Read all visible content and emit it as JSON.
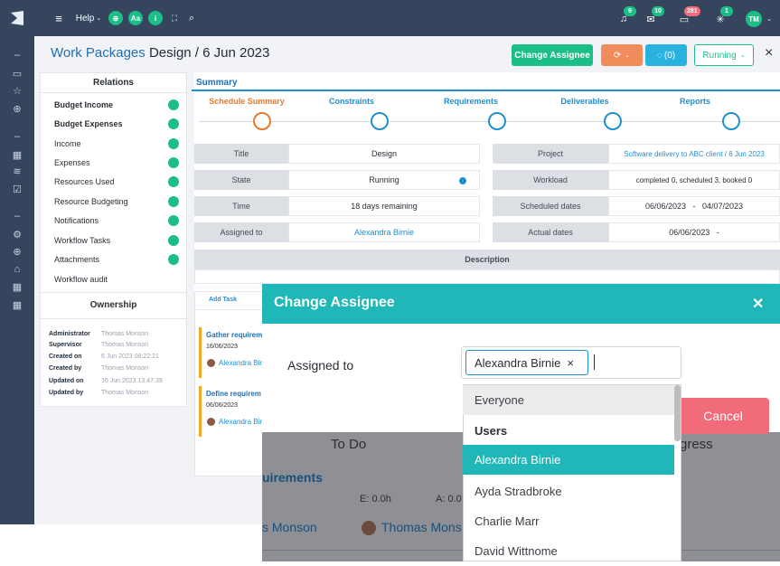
{
  "topbar": {
    "help_label": "Help",
    "aa_label": "Aa",
    "info_label": "i",
    "badges": [
      "9",
      "10",
      "281",
      "1"
    ],
    "avatar_initials": "TM"
  },
  "header": {
    "breadcrumb_module": "Work Packages",
    "record_title": "Design / 6 Jun 2023",
    "change_assignee_label": "Change Assignee",
    "comments_label": "(0)",
    "status_label": "Running",
    "close_label": "×"
  },
  "relations": {
    "title": "Relations",
    "items": [
      {
        "label": "Budget Income",
        "bold": true
      },
      {
        "label": "Budget Expenses",
        "bold": true
      },
      {
        "label": "Income",
        "bold": false
      },
      {
        "label": "Expenses",
        "bold": false
      },
      {
        "label": "Resources Used",
        "bold": false
      },
      {
        "label": "Resource Budgeting",
        "bold": false
      },
      {
        "label": "Notifications",
        "bold": false
      },
      {
        "label": "Workflow Tasks",
        "bold": false
      },
      {
        "label": "Attachments",
        "bold": false
      },
      {
        "label": "Workflow audit",
        "bold": false
      }
    ]
  },
  "ownership": {
    "title": "Ownership",
    "rows": [
      {
        "key": "Administrator",
        "value": "Thomas Monson"
      },
      {
        "key": "Supervisor",
        "value": "Thomas Monson"
      },
      {
        "key": "Created on",
        "value": "6 Jun 2023 08:22:21"
      },
      {
        "key": "Created by",
        "value": "Thomas Monson"
      },
      {
        "key": "Updated on",
        "value": "16 Jun 2023 13:47:39"
      },
      {
        "key": "Updated by",
        "value": "Thomas Monson"
      }
    ]
  },
  "summary": {
    "tab_label": "Summary",
    "steps": [
      "Schedule Summary",
      "Constraints",
      "Requirements",
      "Deliverables",
      "Reports"
    ],
    "fields": {
      "title_k": "Title",
      "title_v": "Design",
      "state_k": "State",
      "state_v": "Running",
      "time_k": "Time",
      "time_v": "18 days remaining",
      "assigned_k": "Assigned to",
      "assigned_v": "Alexandra Birnie",
      "project_k": "Project",
      "project_v": "Software delivery to ABC client / 6 Jun 2023",
      "workload_k": "Workload",
      "workload_v": "completed 0, scheduled 3, booked 0",
      "sched_k": "Scheduled dates",
      "sched_v": "06/06/2023   -   04/07/2023",
      "actual_k": "Actual dates",
      "actual_v": "06/06/2023   -"
    },
    "description_label": "Description"
  },
  "tasks": {
    "add_task_label": "Add Task",
    "cards": [
      {
        "title": "Gather requirem",
        "date": "16/06/2023",
        "assignee": "Alexandra Bir"
      },
      {
        "title": "Define requirem",
        "date": "06/06/2023",
        "assignee": "Alexandra Bir"
      }
    ]
  },
  "background_board": {
    "todo_label": "To Do",
    "progress_label": "gress",
    "requirements_label": "uirements",
    "est_label": "E: 0.0h",
    "act_label": "A: 0.0",
    "user_a": "s Monson",
    "user_b": "Thomas Mons"
  },
  "modal": {
    "title": "Change Assignee",
    "close_label": "✕",
    "field_label": "Assigned to",
    "selected_tag": "Alexandra Birnie",
    "tag_remove": "×",
    "cancel_label": "Cancel",
    "dropdown": {
      "everyone": "Everyone",
      "group_users": "Users",
      "options": [
        "Alexandra Birnie",
        "Ayda Stradbroke",
        "Charlie Marr",
        "David Wittnome"
      ],
      "highlighted_index": 0
    }
  },
  "colors": {
    "topbar_bg": "#35455d",
    "accent_green": "#1bbf86",
    "accent_teal": "#1fb7b7",
    "link_blue": "#1e8fd0",
    "orange": "#f08c5a",
    "cancel_red": "#f26b7a"
  }
}
